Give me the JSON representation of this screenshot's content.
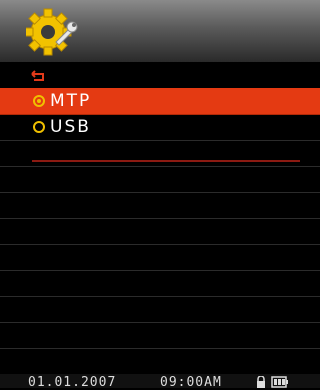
{
  "header": {
    "icon": "settings-gear-wrench-icon"
  },
  "menu": {
    "back_icon": "back-arrow-icon",
    "items": [
      {
        "label": "MTP",
        "selected": true
      },
      {
        "label": "USB",
        "selected": false
      }
    ]
  },
  "status_bar": {
    "date": "01.01.2007",
    "time": "09:00AM",
    "lock_icon": "lock-icon",
    "battery_icon": "battery-icon"
  },
  "colors": {
    "selection": "#e43a12",
    "radio": "#f0c000",
    "divider": "#8c1a12",
    "back_arrow": "#e23a1a"
  }
}
